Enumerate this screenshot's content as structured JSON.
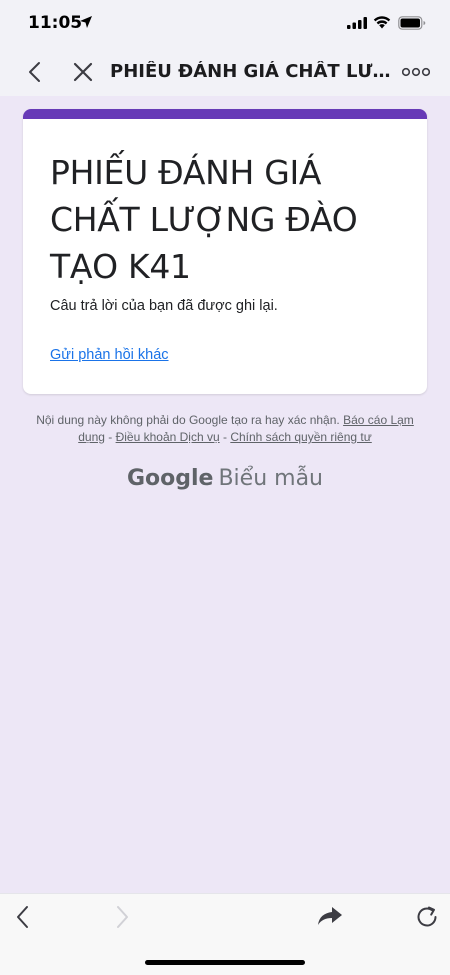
{
  "status_bar": {
    "time": "11:05",
    "icons": [
      "location-arrow-icon",
      "signal-bars-icon",
      "wifi-icon",
      "battery-icon"
    ]
  },
  "browser_nav": {
    "title": "PHIẾU ĐÁNH GIÁ CHẤT LƯỢ...",
    "icons": [
      "back-chevron-icon",
      "close-x-icon",
      "more-dots-icon"
    ]
  },
  "form_card": {
    "title": "PHIẾU ĐÁNH GIÁ CHẤT LƯỢNG ĐÀO TẠO K41",
    "message": "Câu trả lời của bạn đã được ghi lại.",
    "link": "Gửi phản hồi khác",
    "accent_color": "#673ab7"
  },
  "footer": {
    "disclaimer": "Nội dung này không phải do Google tạo ra hay xác nhận.",
    "report_abuse": "Báo cáo Lạm dụng",
    "separator": " - ",
    "terms": "Điều khoản Dịch vụ",
    "privacy": "Chính sách quyền riêng tư"
  },
  "branding": {
    "google": "Google",
    "product": "Biểu mẫu"
  },
  "toolbar": {
    "icons": [
      "back-arrow-icon",
      "forward-arrow-icon",
      "share-arrow-icon",
      "reload-icon"
    ]
  },
  "colors": {
    "page_background": "#ede7f6",
    "link": "#1a73e8"
  }
}
